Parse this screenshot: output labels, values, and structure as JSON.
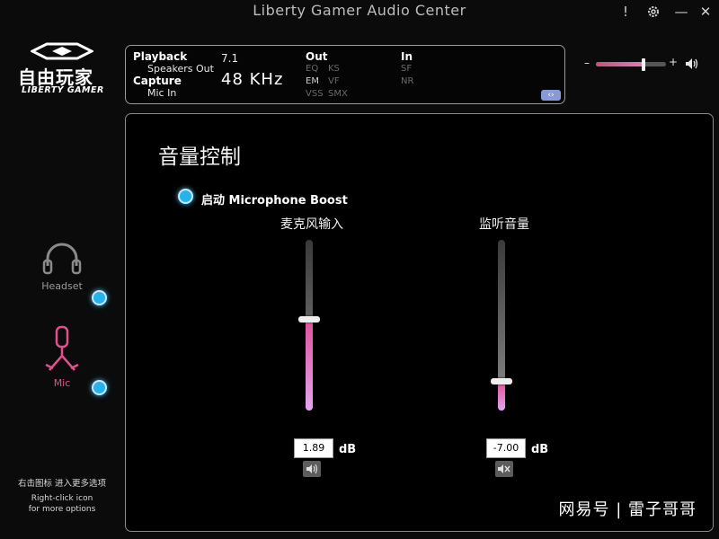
{
  "window": {
    "title": "Liberty Gamer Audio Center"
  },
  "logo": {
    "cn": "自由玩家",
    "en": "LIBERTY GAMER"
  },
  "info": {
    "playback_label": "Playback",
    "playback_device": "Speakers Out",
    "capture_label": "Capture",
    "capture_device": "Mic In",
    "channels": "7.1",
    "sample_rate": "48 KHz",
    "out_label": "Out",
    "out_features": [
      "EQ",
      "KS",
      "EM",
      "VF",
      "VSS",
      "SMX"
    ],
    "in_label": "In",
    "in_features": [
      "SF",
      "NR"
    ]
  },
  "master_volume": {
    "minus": "–",
    "plus": "+",
    "level": 0.68
  },
  "devices": [
    {
      "label": "Headset",
      "selected": false
    },
    {
      "label": "Mic",
      "selected": true
    }
  ],
  "hint": {
    "cn": "右击图标 进入更多选项",
    "en_line1": "Right-click icon",
    "en_line2": "for more options"
  },
  "panel": {
    "title": "音量控制",
    "boost_label": "启动 Microphone Boost",
    "mic_input": {
      "title": "麦克风输入",
      "value": "1.89",
      "unit": "dB",
      "level": 0.53
    },
    "monitor": {
      "title": "监听音量",
      "value": "-7.00",
      "unit": "dB",
      "level": 0.17
    }
  },
  "watermark": "网易号 | 雷子哥哥",
  "colors": {
    "accent_pink": "#e0529a",
    "indicator_blue": "#23b4ee",
    "mic_active": "#e2508c"
  }
}
